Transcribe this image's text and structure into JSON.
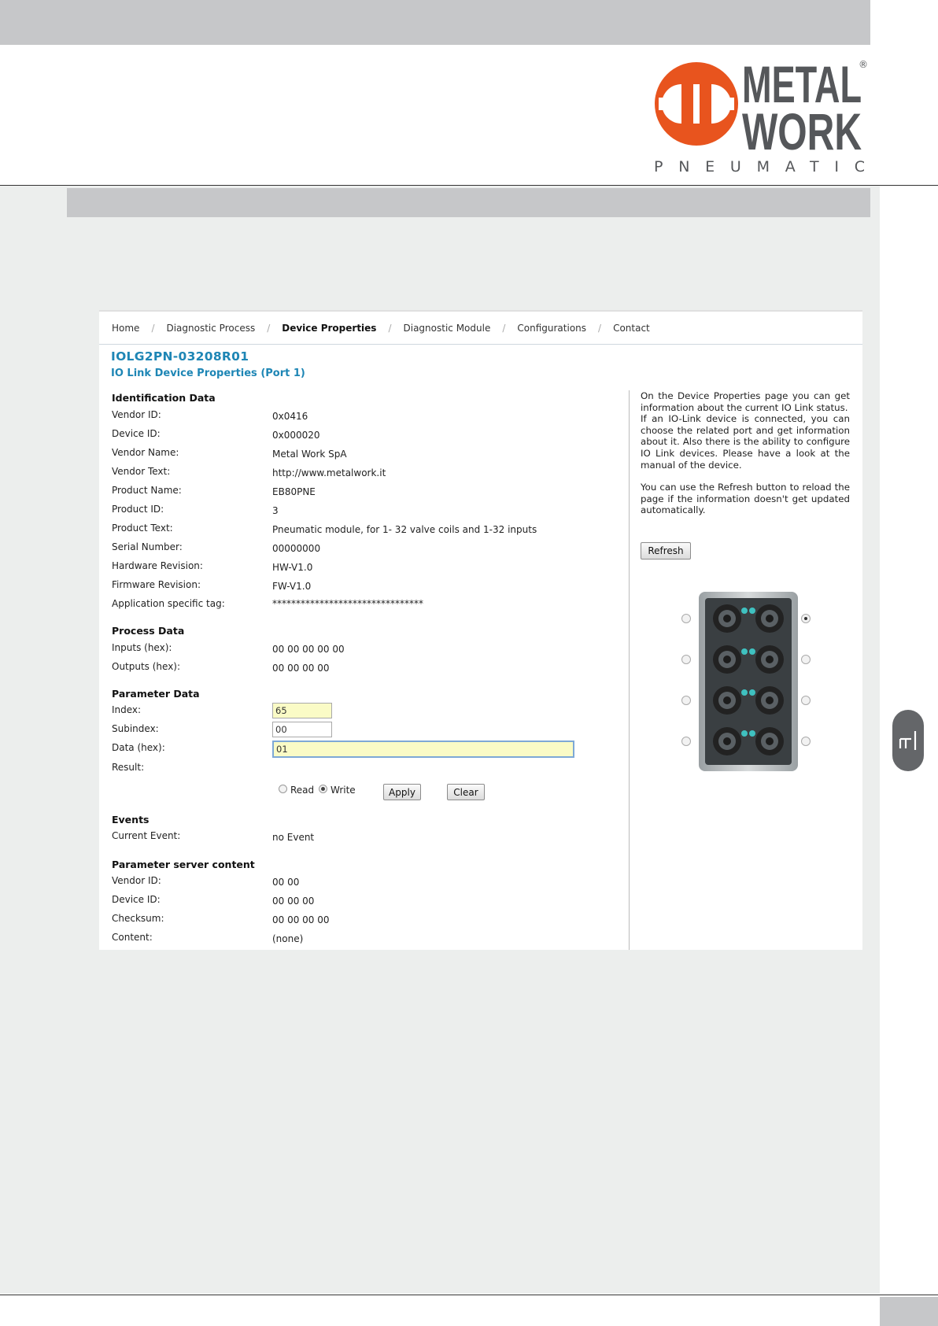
{
  "brand": {
    "logo_line1": "METAL",
    "logo_line2": "WORK",
    "tagline": "PNEUMATIC",
    "registered": "®",
    "logo_color": "#e8541e",
    "logo_text_color": "#55575a"
  },
  "side_tab": {
    "label": "IT"
  },
  "nav": {
    "items": [
      "Home",
      "Diagnostic Process",
      "Device Properties",
      "Diagnostic Module",
      "Configurations",
      "Contact"
    ],
    "active": "Device Properties",
    "separator": "/"
  },
  "device": {
    "title": "IOLG2PN-03208R01",
    "subtitle": "IO Link Device Properties (Port 1)"
  },
  "identification": {
    "heading": "Identification Data",
    "rows": [
      {
        "label": "Vendor ID:",
        "value": "0x0416"
      },
      {
        "label": "Device ID:",
        "value": "0x000020"
      },
      {
        "label": "Vendor Name:",
        "value": "Metal Work SpA"
      },
      {
        "label": "Vendor Text:",
        "value": "http://www.metalwork.it"
      },
      {
        "label": "Product Name:",
        "value": "EB80PNE"
      },
      {
        "label": "Product ID:",
        "value": "3"
      },
      {
        "label": "Product Text:",
        "value": "Pneumatic module, for 1- 32 valve coils and 1-32 inputs"
      },
      {
        "label": "Serial Number:",
        "value": "00000000"
      },
      {
        "label": "Hardware Revision:",
        "value": "HW-V1.0"
      },
      {
        "label": "Firmware Revision:",
        "value": "FW-V1.0"
      },
      {
        "label": "Application specific tag:",
        "value": "********************************"
      }
    ]
  },
  "process": {
    "heading": "Process Data",
    "rows": [
      {
        "label": "Inputs (hex):",
        "value": "00 00 00 00 00"
      },
      {
        "label": "Outputs (hex):",
        "value": "00 00 00 00"
      }
    ]
  },
  "parameter": {
    "heading": "Parameter Data",
    "index_label": "Index:",
    "index_value": "65",
    "subindex_label": "Subindex:",
    "subindex_value": "00",
    "data_label": "Data (hex):",
    "data_value": "01",
    "result_label": "Result:",
    "read_label": "Read",
    "write_label": "Write",
    "mode": "Write",
    "apply_label": "Apply",
    "clear_label": "Clear"
  },
  "events": {
    "heading": "Events",
    "rows": [
      {
        "label": "Current Event:",
        "value": "no Event"
      }
    ]
  },
  "param_server": {
    "heading": "Parameter server content",
    "rows": [
      {
        "label": "Vendor ID:",
        "value": "00 00"
      },
      {
        "label": "Device ID:",
        "value": "00 00 00"
      },
      {
        "label": "Checksum:",
        "value": "00 00 00 00"
      },
      {
        "label": "Content:",
        "value": "(none)"
      }
    ]
  },
  "help": {
    "p1": "On the Device Properties page you can get information about the current IO Link status.",
    "p2": "If an IO-Link device is connected, you can choose the related port and get information about it. Also there is the ability to configure IO Link devices. Please have a look at the manual of the device.",
    "p3": "You can use the Refresh button to reload the page if the information doesn't get updated automatically.",
    "refresh_label": "Refresh"
  },
  "ports": {
    "selected": 1
  },
  "colors": {
    "title_blue": "#1e86b5",
    "band_gray": "#c6c7c9",
    "page_bg": "#eceeed",
    "input_yellow": "#fafbc6",
    "led_teal": "#3fc1c0"
  }
}
